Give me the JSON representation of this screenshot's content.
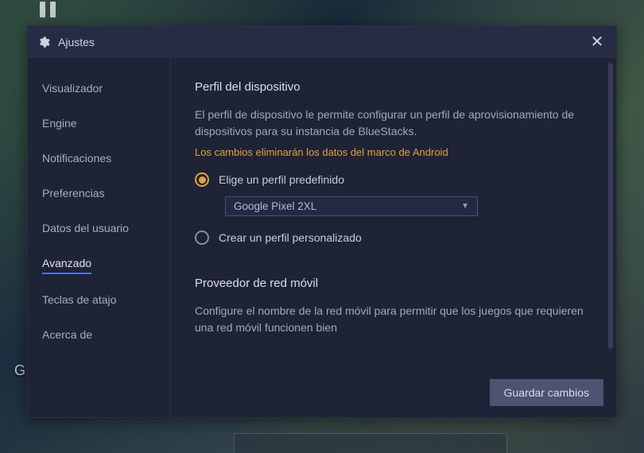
{
  "header": {
    "title": "Ajustes"
  },
  "sidebar": {
    "items": [
      {
        "label": "Visualizador",
        "active": false
      },
      {
        "label": "Engine",
        "active": false
      },
      {
        "label": "Notificaciones",
        "active": false
      },
      {
        "label": "Preferencias",
        "active": false
      },
      {
        "label": "Datos del usuario",
        "active": false
      },
      {
        "label": "Avanzado",
        "active": true
      },
      {
        "label": "Teclas de atajo",
        "active": false
      },
      {
        "label": "Acerca de",
        "active": false
      }
    ]
  },
  "section1": {
    "title": "Perfil del dispositivo",
    "desc": "El perfil de dispositivo le permite configurar un perfil de aprovisionamiento de dispositivos para su instancia de BlueStacks.",
    "warn": "Los cambios eliminarán los datos del marco de Android",
    "radio_predef": "Elige un perfil predefinido",
    "select_value": "Google Pixel 2XL",
    "radio_custom": "Crear un perfil personalizado"
  },
  "section2": {
    "title": "Proveedor de red móvil",
    "desc": "Configure el nombre de la red móvil para permitir que los juegos que requieren una red móvil funcionen bien"
  },
  "footer": {
    "save": "Guardar cambios"
  },
  "bg": {
    "hint": "G"
  }
}
